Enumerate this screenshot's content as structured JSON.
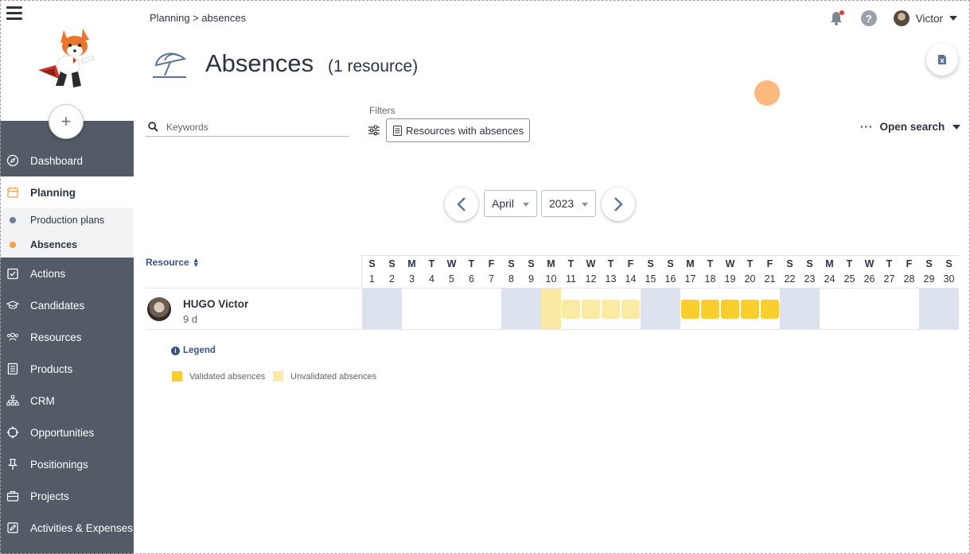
{
  "sidebar": {
    "items": [
      {
        "label": "Dashboard",
        "icon": "compass-icon"
      },
      {
        "label": "Planning",
        "icon": "calendar-icon",
        "active": true
      },
      {
        "label": "Actions",
        "icon": "checklist-icon"
      },
      {
        "label": "Candidates",
        "icon": "graduation-cap-icon"
      },
      {
        "label": "Resources",
        "icon": "people-icon"
      },
      {
        "label": "Products",
        "icon": "document-icon"
      },
      {
        "label": "CRM",
        "icon": "org-chart-icon"
      },
      {
        "label": "Opportunities",
        "icon": "target-icon"
      },
      {
        "label": "Positionings",
        "icon": "pin-icon"
      },
      {
        "label": "Projects",
        "icon": "briefcase-icon"
      },
      {
        "label": "Activities & Expenses",
        "icon": "edit-icon"
      }
    ],
    "subitems": [
      {
        "label": "Production plans",
        "color": "#6b7e99"
      },
      {
        "label": "Absences",
        "color": "#f5a04a",
        "active": true
      }
    ],
    "add_label": "+"
  },
  "header": {
    "breadcrumb": "Planning > absences",
    "user_name": "Victor",
    "help_label": "?"
  },
  "page": {
    "title": "Absences",
    "subtitle": "(1 resource)"
  },
  "search": {
    "placeholder": "Keywords",
    "filters_label": "Filters",
    "filter_chip": "Resources with absences",
    "open_search": "Open search"
  },
  "period": {
    "month": "April",
    "year": "2023"
  },
  "calendar": {
    "resource_header": "Resource",
    "days": [
      {
        "l": "S",
        "n": "1",
        "we": true
      },
      {
        "l": "S",
        "n": "2",
        "we": true
      },
      {
        "l": "M",
        "n": "3"
      },
      {
        "l": "T",
        "n": "4"
      },
      {
        "l": "W",
        "n": "5"
      },
      {
        "l": "T",
        "n": "6"
      },
      {
        "l": "F",
        "n": "7"
      },
      {
        "l": "S",
        "n": "8",
        "we": true
      },
      {
        "l": "S",
        "n": "9",
        "we": true
      },
      {
        "l": "M",
        "n": "10"
      },
      {
        "l": "T",
        "n": "11"
      },
      {
        "l": "W",
        "n": "12"
      },
      {
        "l": "T",
        "n": "13"
      },
      {
        "l": "F",
        "n": "14"
      },
      {
        "l": "S",
        "n": "15",
        "we": true
      },
      {
        "l": "S",
        "n": "16",
        "we": true
      },
      {
        "l": "M",
        "n": "17"
      },
      {
        "l": "T",
        "n": "18"
      },
      {
        "l": "W",
        "n": "19"
      },
      {
        "l": "T",
        "n": "20"
      },
      {
        "l": "F",
        "n": "21"
      },
      {
        "l": "S",
        "n": "22",
        "we": true
      },
      {
        "l": "S",
        "n": "23",
        "we": true
      },
      {
        "l": "M",
        "n": "24"
      },
      {
        "l": "T",
        "n": "25"
      },
      {
        "l": "W",
        "n": "26"
      },
      {
        "l": "T",
        "n": "27"
      },
      {
        "l": "F",
        "n": "28"
      },
      {
        "l": "S",
        "n": "29",
        "we": true
      },
      {
        "l": "S",
        "n": "30",
        "we": true
      }
    ],
    "resources": [
      {
        "name": "HUGO Victor",
        "total": "9 d",
        "holiday_days": [
          10
        ],
        "unvalidated_days": [
          11,
          12,
          13,
          14
        ],
        "validated_days": [
          17,
          18,
          19,
          20,
          21
        ]
      }
    ]
  },
  "legend": {
    "title": "Legend",
    "validated": "Validated absences",
    "unvalidated": "Unvalidated absences"
  },
  "colors": {
    "sidebar_bg": "#525b66",
    "weekend": "#dde3ee",
    "validated": "#f9cf2f",
    "unvalidated": "#fbeaa3",
    "accent": "#f5a04a"
  }
}
